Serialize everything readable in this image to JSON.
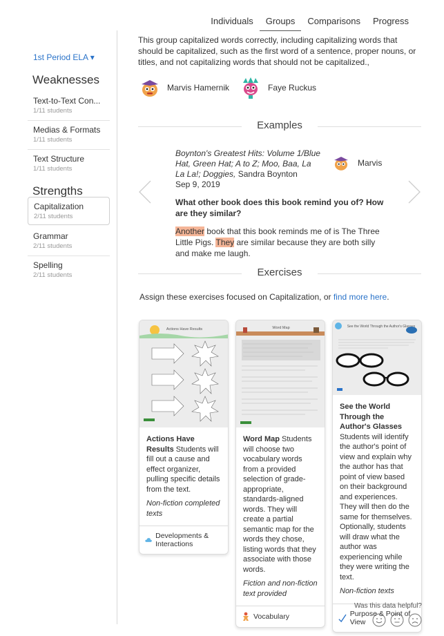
{
  "nav": {
    "tabs": [
      {
        "label": "Individuals"
      },
      {
        "label": "Groups"
      },
      {
        "label": "Comparisons"
      },
      {
        "label": "Progress"
      }
    ],
    "active": "Groups"
  },
  "sidebar": {
    "class_select": "1st Period ELA ▾",
    "weaknesses_heading": "Weaknesses",
    "weaknesses": [
      {
        "name": "Text-to-Text Con...",
        "count": "1/11 students"
      },
      {
        "name": "Medias & Formats",
        "count": "1/11 students"
      },
      {
        "name": "Text Structure",
        "count": "1/11 students"
      }
    ],
    "strengths_heading": "Strengths",
    "strengths": [
      {
        "name": "Capitalization",
        "count": "2/11 students"
      },
      {
        "name": "Grammar",
        "count": "2/11 students"
      },
      {
        "name": "Spelling",
        "count": "2/11 students"
      }
    ]
  },
  "main": {
    "description": "This group capitalized words correctly, including capitalizing words that should be capitalized, such as the first word of a sentence, proper nouns, or titles, and not capitalizing words that should not be capitalized.,",
    "students": [
      {
        "name": "Marvis Hamernik"
      },
      {
        "name": "Faye Ruckus"
      }
    ],
    "examples_title": "Examples",
    "example": {
      "book": "Boynton's Greatest Hits: Volume 1/Blue Hat, Green Hat; A to Z; Moo, Baa, La La La!; Doggies,",
      "author": " Sandra Boynton",
      "date": "Sep 9, 2019",
      "student": "Marvis",
      "question": "What other book does this book remind you of? How are they similar?",
      "answer_hl1": "Another",
      "answer_mid": " book that this book reminds me of is The Three Little Pigs. ",
      "answer_hl2": "They",
      "answer_end": " are similar because they are both silly and make me laugh."
    },
    "exercises_title": "Exercises",
    "assign_text": "Assign these exercises focused on Capitalization, or ",
    "assign_link": "find more here",
    "assign_end": ".",
    "cards": [
      {
        "thumb_title": "Actions Have Results",
        "title": "Actions Have Results",
        "text": " Students will fill out a cause and effect organizer, pulling specific details from the text.",
        "sub": "Non-fiction completed texts",
        "foot": "Developments & Interactions",
        "foot_icon": "cloud-icon"
      },
      {
        "thumb_title": "Word Map",
        "title": "Word Map",
        "text": " Students will choose two vocabulary words from a provided selection of grade-appropriate, standards-aligned words. They will create a partial semantic map for the words they chose, listing words that they associate with those words.",
        "sub": "Fiction and non-fiction text provided",
        "foot": "Vocabulary",
        "foot_icon": "figure-icon"
      },
      {
        "thumb_title": "See the World Through the Author's Glasses",
        "title": "See the World Through the Author's Glasses",
        "text": " Students will identify the author's point of view and explain why the author has that point of view based on their background and experiences. They will then do the same for themselves. Optionally, students will draw what the author was experiencing while they were writing the text.",
        "sub": "Non-fiction texts",
        "foot": "Purpose & Point of View",
        "foot_icon": "check-icon"
      }
    ]
  },
  "feedback": {
    "question": "Was this data helpful?"
  }
}
